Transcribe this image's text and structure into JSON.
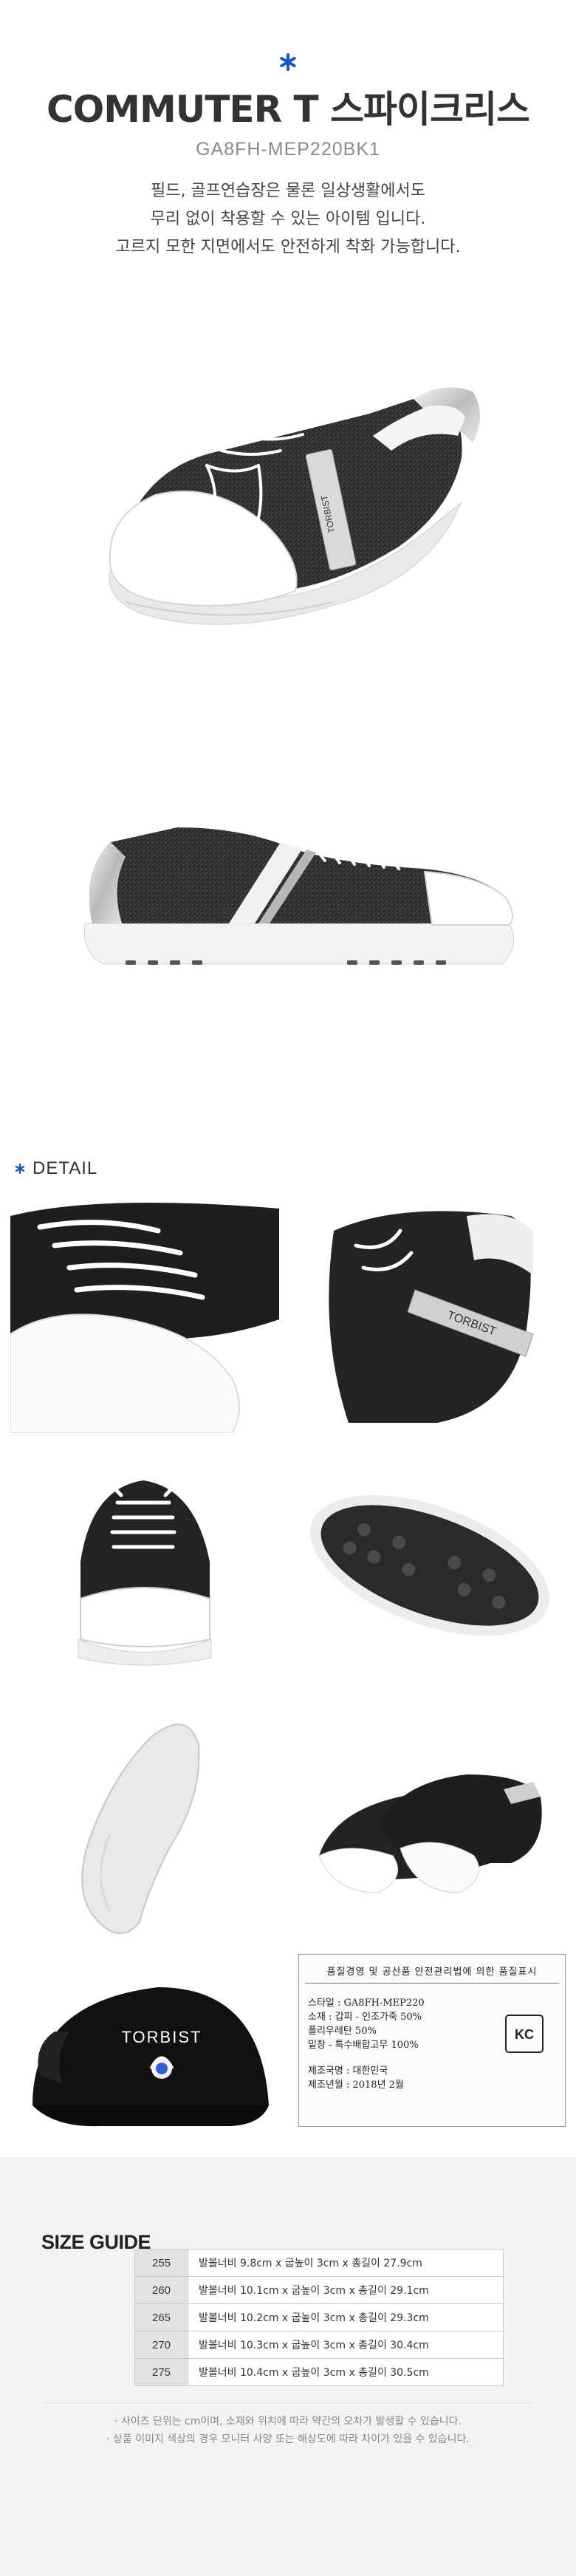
{
  "header": {
    "title": "COMMUTER T 스파이크리스",
    "model_code": "GA8FH-MEP220BK1",
    "description": [
      "필드, 골프연습장은 물론 일상생활에서도",
      "무리 없이 착용할 수 있는 아이템 입니다.",
      "고르지 모한 지면에서도 안전하게 착화 가능합니다."
    ],
    "accent_color": "#1a56c8"
  },
  "brand": {
    "logo_text": "TORBIST"
  },
  "detail": {
    "heading": "DETAIL"
  },
  "label_card": {
    "heading": "품질경영 및 공산품 안전관리법에 의한 품질표시",
    "rows": [
      "스타일 : GA8FH-MEP220",
      "소재 : 갑피 - 인조가죽 50%",
      "         폴리우레탄 50%",
      "     밑창 - 특수배합고무 100%",
      "제조국명 : 대한민국",
      "제조년월 : 2018년 2월"
    ],
    "cert_mark": "KC"
  },
  "size_guide": {
    "title": "SIZE GUIDE",
    "rows": [
      {
        "size": "255",
        "spec": "발볼너비 9.8cm x 굽높이 3cm x 총길이 27.9cm"
      },
      {
        "size": "260",
        "spec": "발볼너비 10.1cm x 굽높이 3cm x 총길이 29.1cm"
      },
      {
        "size": "265",
        "spec": "발볼너비 10.2cm x 굽높이 3cm x 총길이 29.3cm"
      },
      {
        "size": "270",
        "spec": "발볼너비 10.3cm x 굽높이 3cm x 총길이 30.4cm"
      },
      {
        "size": "275",
        "spec": "발볼너비 10.4cm x 굽높이 3cm x 총길이 30.5cm"
      }
    ],
    "notes": [
      "· 사이즈 단위는 cm이며, 소재와 위치에 따라 약간의 오차가 발생할 수 있습니다.",
      "· 상품 이미지 색상의 경우 모니터 사양 또는 해상도에 따라 차이가 있을 수 있습니다."
    ]
  }
}
